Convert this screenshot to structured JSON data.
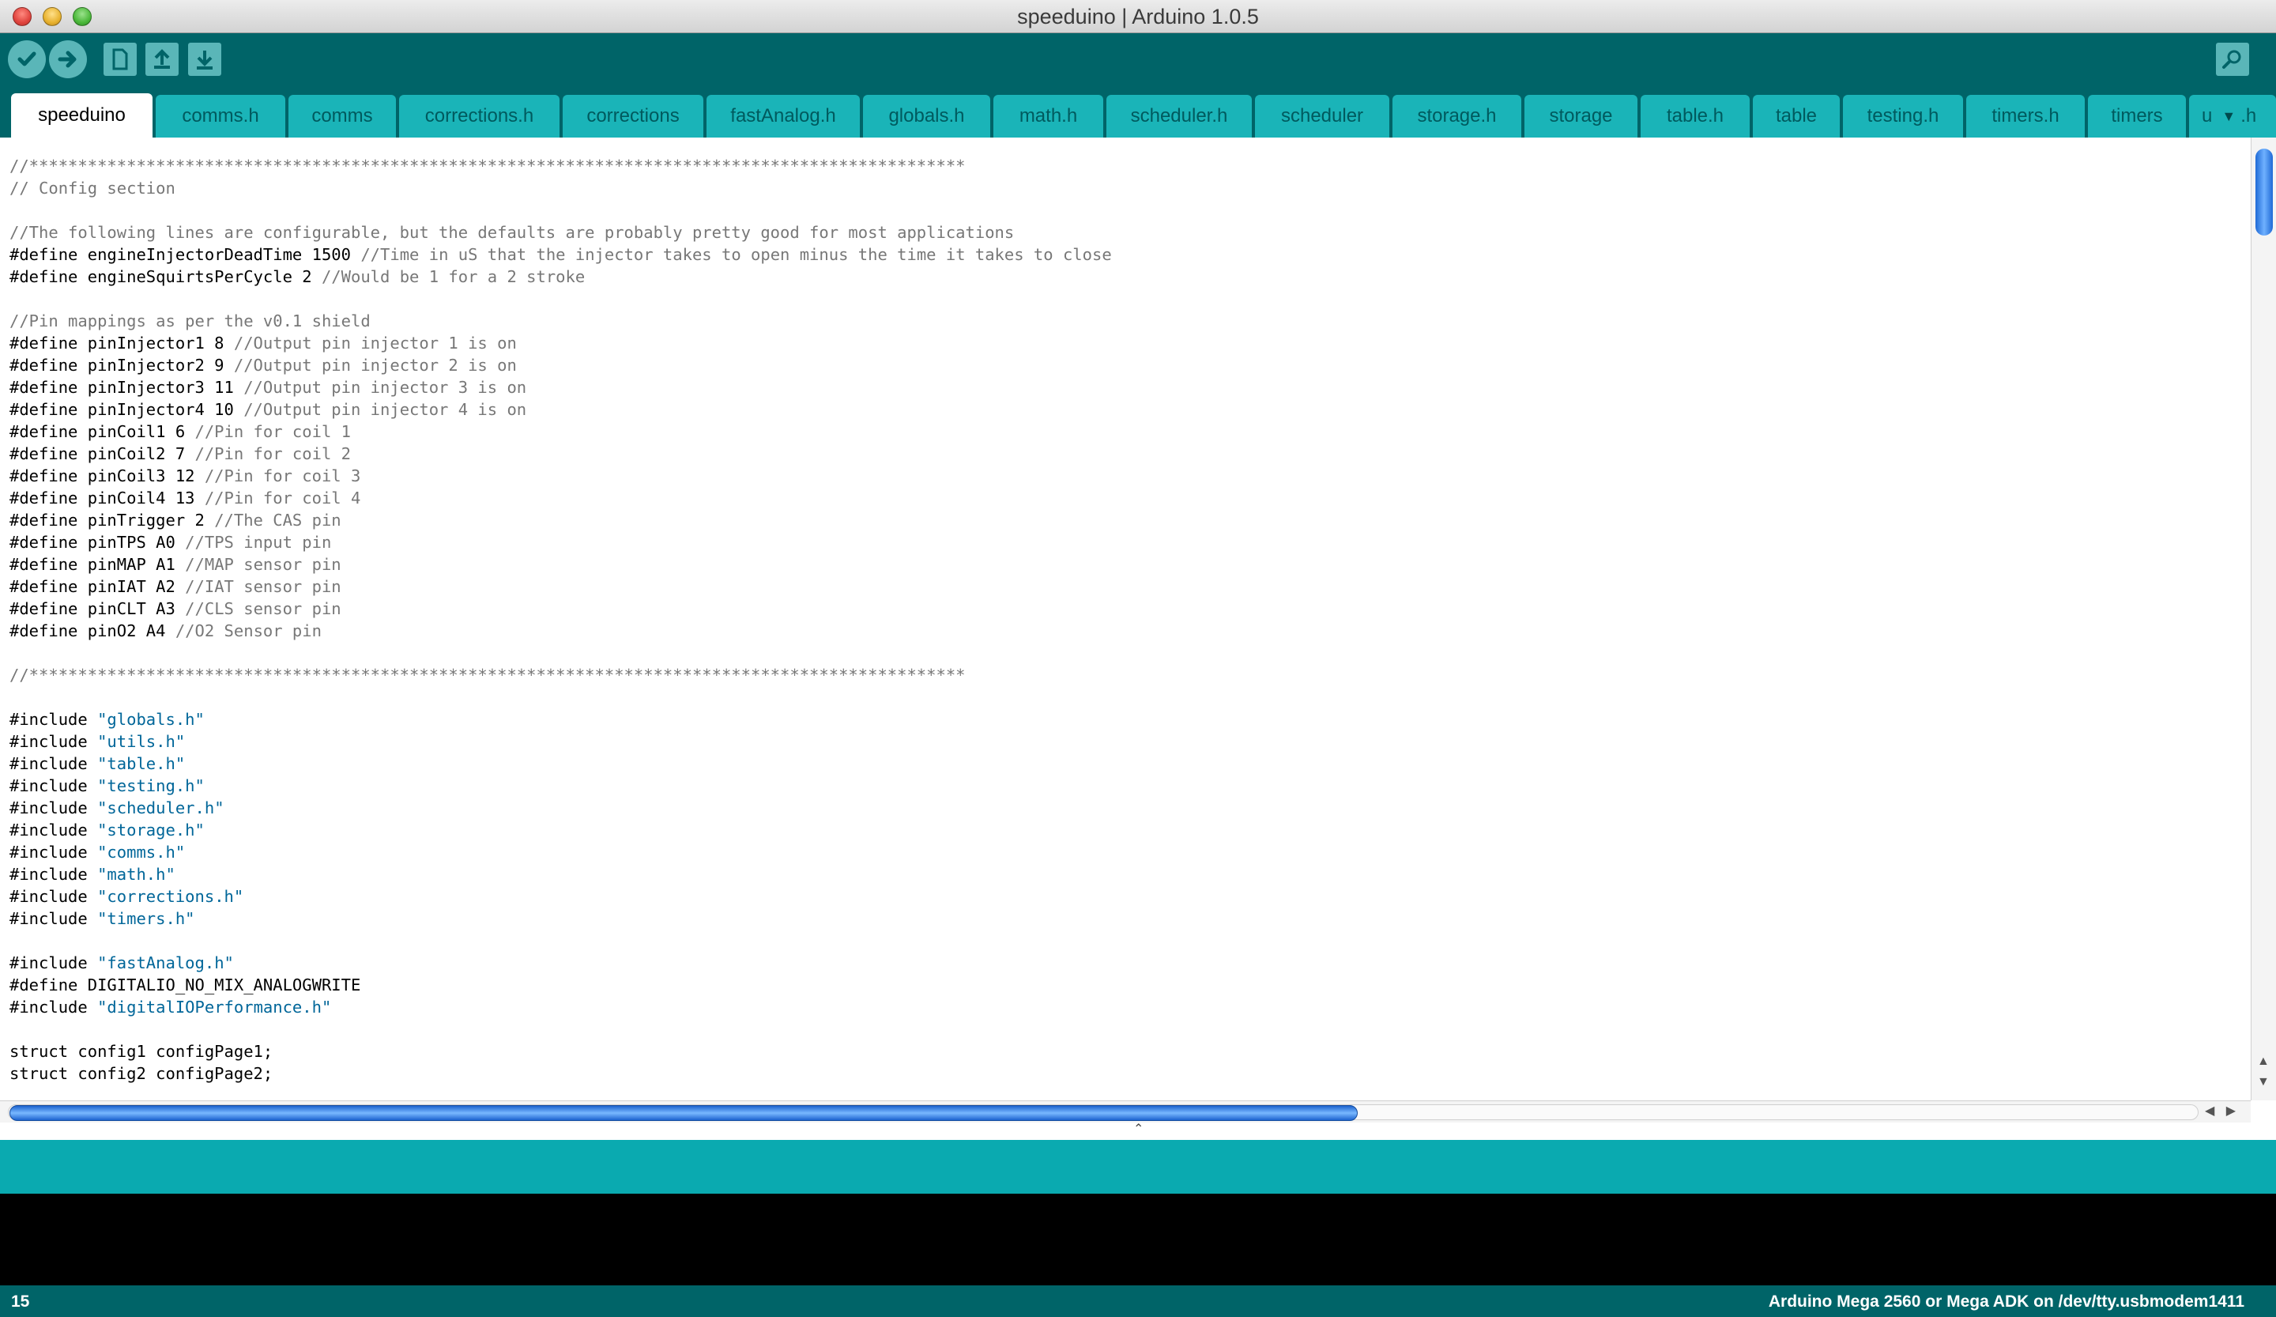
{
  "window": {
    "title": "speeduino | Arduino 1.0.5"
  },
  "toolbar": {
    "verify": "check-icon",
    "upload": "arrow-right-icon",
    "new": "new-file-icon",
    "open": "open-arrow-up-icon",
    "save": "save-arrow-down-icon",
    "serial_monitor": "magnifier-icon"
  },
  "tabs": [
    {
      "label": "speeduino",
      "active": true
    },
    {
      "label": "comms.h"
    },
    {
      "label": "comms"
    },
    {
      "label": "corrections.h"
    },
    {
      "label": "corrections"
    },
    {
      "label": "fastAnalog.h"
    },
    {
      "label": "globals.h"
    },
    {
      "label": "math.h"
    },
    {
      "label": "scheduler.h"
    },
    {
      "label": "scheduler"
    },
    {
      "label": "storage.h"
    },
    {
      "label": "storage"
    },
    {
      "label": "table.h"
    },
    {
      "label": "table"
    },
    {
      "label": "testing.h"
    },
    {
      "label": "timers.h"
    },
    {
      "label": "timers"
    },
    {
      "label": "u"
    }
  ],
  "tab_overflow_suffix": ".h",
  "code_lines": [
    [
      [
        "c",
        "//************************************************************************************************"
      ]
    ],
    [
      [
        "c",
        "// Config section"
      ]
    ],
    [],
    [
      [
        "c",
        "//The following lines are configurable, but the defaults are probably pretty good for most applications"
      ]
    ],
    [
      [
        "k",
        "#define engineInjectorDeadTime 1500 "
      ],
      [
        "c",
        "//Time in uS that the injector takes to open minus the time it takes to close"
      ]
    ],
    [
      [
        "k",
        "#define engineSquirtsPerCycle 2 "
      ],
      [
        "c",
        "//Would be 1 for a 2 stroke"
      ]
    ],
    [],
    [
      [
        "c",
        "//Pin mappings as per the v0.1 shield"
      ]
    ],
    [
      [
        "k",
        "#define pinInjector1 8 "
      ],
      [
        "c",
        "//Output pin injector 1 is on"
      ]
    ],
    [
      [
        "k",
        "#define pinInjector2 9 "
      ],
      [
        "c",
        "//Output pin injector 2 is on"
      ]
    ],
    [
      [
        "k",
        "#define pinInjector3 11 "
      ],
      [
        "c",
        "//Output pin injector 3 is on"
      ]
    ],
    [
      [
        "k",
        "#define pinInjector4 10 "
      ],
      [
        "c",
        "//Output pin injector 4 is on"
      ]
    ],
    [
      [
        "k",
        "#define pinCoil1 6 "
      ],
      [
        "c",
        "//Pin for coil 1"
      ]
    ],
    [
      [
        "k",
        "#define pinCoil2 7 "
      ],
      [
        "c",
        "//Pin for coil 2"
      ]
    ],
    [
      [
        "k",
        "#define pinCoil3 12 "
      ],
      [
        "c",
        "//Pin for coil 3"
      ]
    ],
    [
      [
        "k",
        "#define pinCoil4 13 "
      ],
      [
        "c",
        "//Pin for coil 4"
      ]
    ],
    [
      [
        "k",
        "#define pinTrigger 2 "
      ],
      [
        "c",
        "//The CAS pin"
      ]
    ],
    [
      [
        "k",
        "#define pinTPS A0 "
      ],
      [
        "c",
        "//TPS input pin"
      ]
    ],
    [
      [
        "k",
        "#define pinMAP A1 "
      ],
      [
        "c",
        "//MAP sensor pin"
      ]
    ],
    [
      [
        "k",
        "#define pinIAT A2 "
      ],
      [
        "c",
        "//IAT sensor pin"
      ]
    ],
    [
      [
        "k",
        "#define pinCLT A3 "
      ],
      [
        "c",
        "//CLS sensor pin"
      ]
    ],
    [
      [
        "k",
        "#define pinO2 A4 "
      ],
      [
        "c",
        "//O2 Sensor pin"
      ]
    ],
    [],
    [
      [
        "c",
        "//************************************************************************************************"
      ]
    ],
    [],
    [
      [
        "k",
        "#include "
      ],
      [
        "s",
        "\"globals.h\""
      ]
    ],
    [
      [
        "k",
        "#include "
      ],
      [
        "s",
        "\"utils.h\""
      ]
    ],
    [
      [
        "k",
        "#include "
      ],
      [
        "s",
        "\"table.h\""
      ]
    ],
    [
      [
        "k",
        "#include "
      ],
      [
        "s",
        "\"testing.h\""
      ]
    ],
    [
      [
        "k",
        "#include "
      ],
      [
        "s",
        "\"scheduler.h\""
      ]
    ],
    [
      [
        "k",
        "#include "
      ],
      [
        "s",
        "\"storage.h\""
      ]
    ],
    [
      [
        "k",
        "#include "
      ],
      [
        "s",
        "\"comms.h\""
      ]
    ],
    [
      [
        "k",
        "#include "
      ],
      [
        "s",
        "\"math.h\""
      ]
    ],
    [
      [
        "k",
        "#include "
      ],
      [
        "s",
        "\"corrections.h\""
      ]
    ],
    [
      [
        "k",
        "#include "
      ],
      [
        "s",
        "\"timers.h\""
      ]
    ],
    [],
    [
      [
        "k",
        "#include "
      ],
      [
        "s",
        "\"fastAnalog.h\""
      ]
    ],
    [
      [
        "k",
        "#define DIGITALIO_NO_MIX_ANALOGWRITE"
      ]
    ],
    [
      [
        "k",
        "#include "
      ],
      [
        "s",
        "\"digitalIOPerformance.h\""
      ]
    ],
    [],
    [
      [
        "k",
        "struct config1 configPage1;"
      ]
    ],
    [
      [
        "k",
        "struct config2 configPage2;"
      ]
    ]
  ],
  "footer": {
    "line_number": "15",
    "board": "Arduino Mega 2560 or Mega ADK on /dev/tty.usbmodem1411"
  },
  "colors": {
    "toolbar_bg": "#006468",
    "tab_bg": "#1ab4b8",
    "status_bg": "#0aaab0",
    "comment": "#777777",
    "string": "#006699"
  }
}
